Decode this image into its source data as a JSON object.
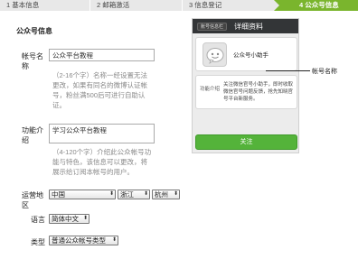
{
  "steps": [
    {
      "label": "1 基本信息"
    },
    {
      "label": "2 邮箱激活"
    },
    {
      "label": "3 信息登记"
    },
    {
      "label": "4 公众号信息"
    }
  ],
  "section_title": "公众号信息",
  "form": {
    "account_name": {
      "label": "帐号名称",
      "value": "公众平台教程",
      "hint": "（2-16个字）名称一经设置无法更改，如果有同名的微博认证帐号，粉丝满500后可进行自助认证。"
    },
    "intro": {
      "label": "功能介绍",
      "value": "学习公众平台教程",
      "hint": "（4-120个字）介绍此公众帐号功能与特色，该信息可以更改，将展示给订阅本帐号的用户。"
    },
    "region": {
      "label": "运营地区",
      "country": "中国",
      "province": "浙江",
      "city": "杭州"
    },
    "language": {
      "label": "语言",
      "value": "简体中文"
    },
    "type": {
      "label": "类型",
      "value": "普通公众帐号类型"
    }
  },
  "preview": {
    "back_label": "账号信息栏",
    "title": "详细资料",
    "account_name": "公众号小助手",
    "intro_label": "功能介绍",
    "intro_text": "关注微信官号小助手，即时收取微信官号问题反馈，抢先知晓官号平台新服务。",
    "follow_label": "关注"
  },
  "callout": {
    "label": "帐号名称"
  },
  "colors": {
    "accent": "#7ab52d",
    "follow": "#54b33a",
    "header": "#333537"
  }
}
